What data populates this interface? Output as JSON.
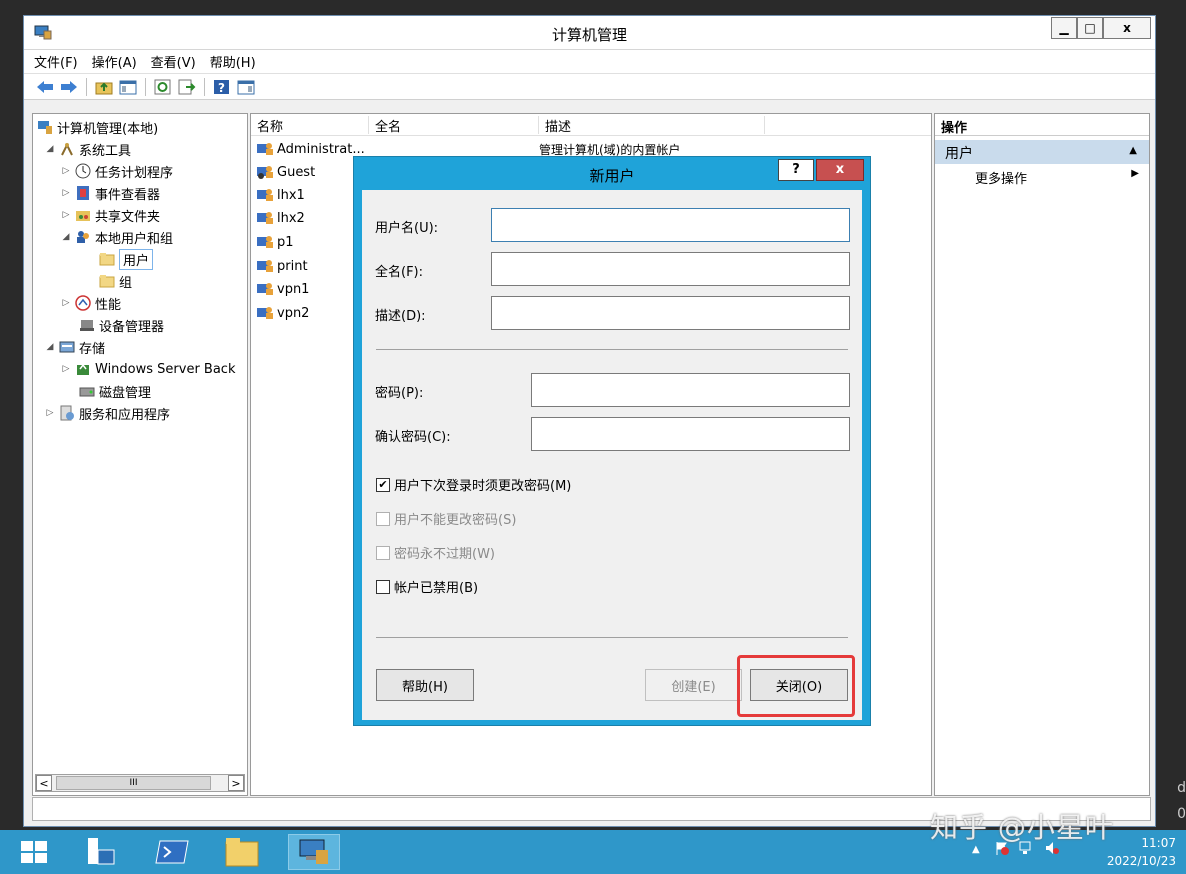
{
  "window": {
    "title": "计算机管理",
    "controls": {
      "minimize": "▁",
      "maximize": "□",
      "close": "x"
    }
  },
  "menubar": [
    "文件(F)",
    "操作(A)",
    "查看(V)",
    "帮助(H)"
  ],
  "tree": {
    "items": [
      {
        "label": "计算机管理(本地)",
        "arrow": "",
        "icon": "computer-management-icon"
      },
      {
        "label": "系统工具",
        "arrow": "◢",
        "icon": "system-tools-icon"
      },
      {
        "label": "任务计划程序",
        "arrow": "▷",
        "icon": "task-scheduler-icon"
      },
      {
        "label": "事件查看器",
        "arrow": "▷",
        "icon": "event-viewer-icon"
      },
      {
        "label": "共享文件夹",
        "arrow": "▷",
        "icon": "shared-folders-icon"
      },
      {
        "label": "本地用户和组",
        "arrow": "◢",
        "icon": "local-users-groups-icon"
      },
      {
        "label": "用户",
        "arrow": "",
        "icon": "folder-icon"
      },
      {
        "label": "组",
        "arrow": "",
        "icon": "folder-icon"
      },
      {
        "label": "性能",
        "arrow": "▷",
        "icon": "performance-icon"
      },
      {
        "label": "设备管理器",
        "arrow": "",
        "icon": "device-manager-icon"
      },
      {
        "label": "存储",
        "arrow": "◢",
        "icon": "storage-icon"
      },
      {
        "label": "Windows Server Back",
        "arrow": "▷",
        "icon": "windows-server-backup-icon"
      },
      {
        "label": "磁盘管理",
        "arrow": "",
        "icon": "disk-management-icon"
      },
      {
        "label": "服务和应用程序",
        "arrow": "▷",
        "icon": "services-applications-icon"
      }
    ],
    "scroll_thumb": "III",
    "scroll_left": "<",
    "scroll_right": ">"
  },
  "list": {
    "columns": [
      "名称",
      "全名",
      "描述"
    ],
    "rows": [
      {
        "name": "Administrat...",
        "desc": "管理计算机(域)的内置帐户"
      },
      {
        "name": "Guest",
        "desc": ""
      },
      {
        "name": "lhx1",
        "desc": ""
      },
      {
        "name": "lhx2",
        "desc": ""
      },
      {
        "name": "p1",
        "desc": ""
      },
      {
        "name": "print",
        "desc": ""
      },
      {
        "name": "vpn1",
        "desc": ""
      },
      {
        "name": "vpn2",
        "desc": ""
      }
    ]
  },
  "actions": {
    "title": "操作",
    "section": "用户",
    "section_caret": "▲",
    "item": "更多操作",
    "item_caret": "▶"
  },
  "dialog": {
    "title": "新用户",
    "help_btn": "?",
    "close_btn": "x",
    "username_label": "用户名(U):",
    "fullname_label": "全名(F):",
    "description_label": "描述(D):",
    "password_label": "密码(P):",
    "confirm_label": "确认密码(C):",
    "cb_must_change": "用户下次登录时须更改密码(M)",
    "cb_cannot_change": "用户不能更改密码(S)",
    "cb_never_expires": "密码永不过期(W)",
    "cb_disabled": "帐户已禁用(B)",
    "checked_mark": "✔",
    "help_button": "帮助(H)",
    "create_button": "创建(E)",
    "close_button": "关闭(O)"
  },
  "taskbar": {
    "time": "11:07",
    "date": "2022/10/23"
  },
  "watermark": "知乎 @小星叶",
  "edge_letters": [
    "d",
    "0"
  ]
}
